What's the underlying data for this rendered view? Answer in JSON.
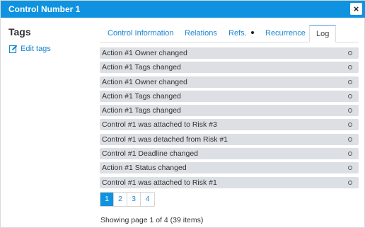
{
  "header": {
    "title": "Control Number 1",
    "close_label": "×"
  },
  "sidebar": {
    "title": "Tags",
    "edit_label": "Edit tags"
  },
  "tabs": [
    {
      "label": "Control Information"
    },
    {
      "label": "Relations"
    },
    {
      "label": "Refs."
    },
    {
      "label": "Recurrence"
    },
    {
      "label": "Log"
    }
  ],
  "log": [
    "Action #1 Owner changed",
    "Action #1 Tags changed",
    "Action #1 Owner changed",
    "Action #1 Tags changed",
    "Action #1 Tags changed",
    "Control #1 was attached to Risk #3",
    "Control #1 was detached from Risk #1",
    "Control #1 Deadline changed",
    "Action #1 Status changed",
    "Control #1 was attached to Risk #1"
  ],
  "pagination": {
    "pages": [
      "1",
      "2",
      "3",
      "4"
    ],
    "current": "1"
  },
  "summary": "Showing page 1 of 4 (39 items)",
  "colors": {
    "header": "#0f93e0",
    "link": "#1a86d0",
    "row": "#dcdfe3"
  }
}
